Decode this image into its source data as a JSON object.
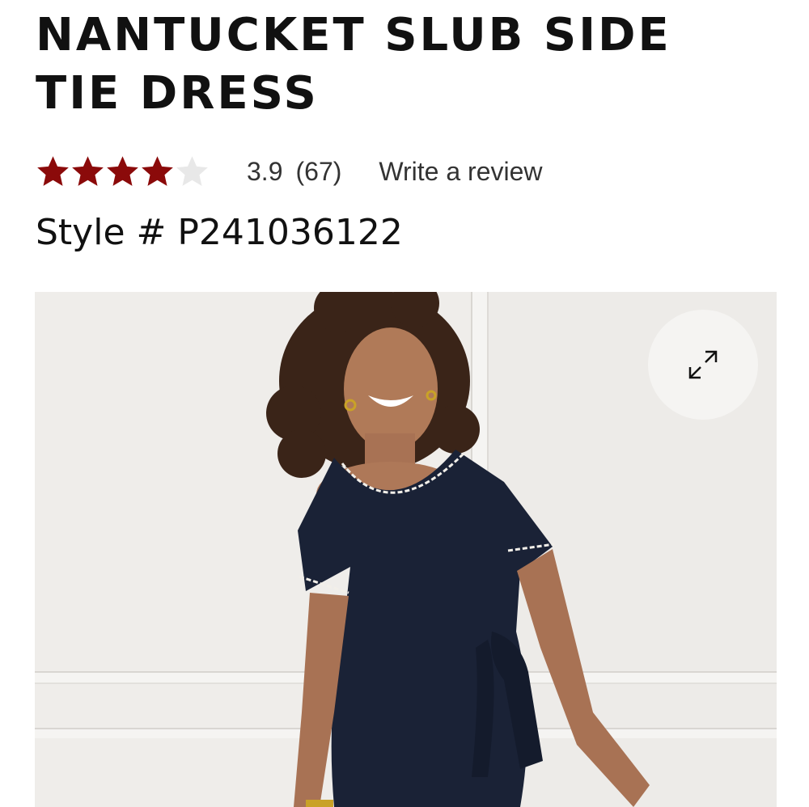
{
  "product": {
    "title": "NANTUCKET SLUB SIDE TIE DRESS",
    "style_label": "Style #",
    "style_number": "P241036122"
  },
  "rating": {
    "value": "3.9",
    "count": "(67)",
    "stars_filled": 4,
    "stars_total": 5,
    "write_review_label": "Write a review"
  },
  "colors": {
    "star_filled": "#8b0a0a",
    "star_empty": "#e8e8e8",
    "dress_navy": "#1a2236"
  },
  "gallery": {
    "image_subject": "model-in-navy-side-tie-dress",
    "expand_icon": "expand-arrows-icon"
  }
}
